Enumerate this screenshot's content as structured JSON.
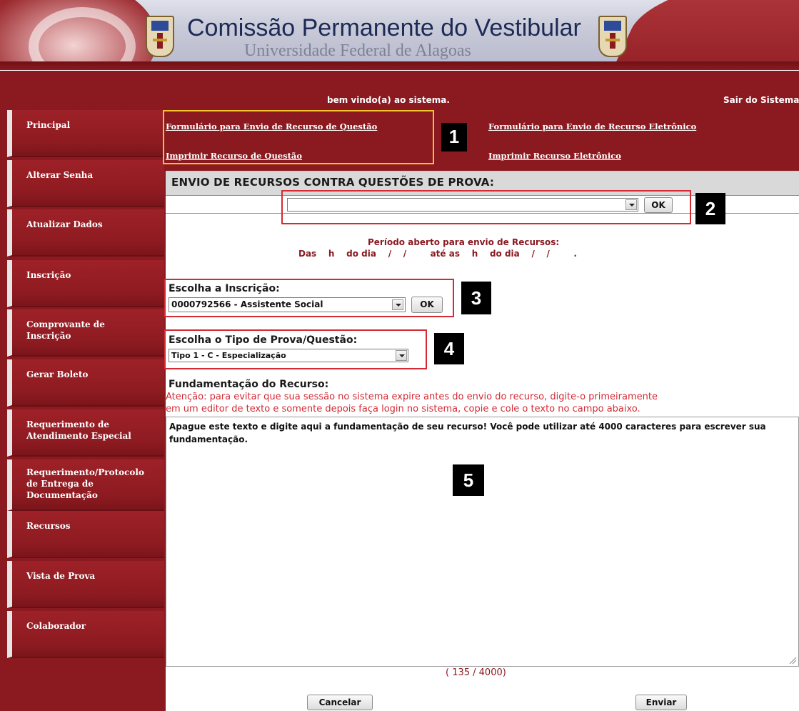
{
  "header": {
    "title": "Comissão Permanente do Vestibular",
    "subtitle": "Universidade Federal de Alagoas"
  },
  "topbar": {
    "welcome": "bem vindo(a) ao sistema.",
    "logout": "Sair do Sistema"
  },
  "sidebar": {
    "items": [
      {
        "label": "Principal"
      },
      {
        "label": "Alterar Senha"
      },
      {
        "label": "Atualizar Dados"
      },
      {
        "label": "Inscrição"
      },
      {
        "label": "Comprovante de\nInscrição"
      },
      {
        "label": "Gerar Boleto"
      },
      {
        "label": "Requerimento de\nAtendimento Especial"
      },
      {
        "label": "Requerimento/Protocolo\nde Entrega de\nDocumentação"
      },
      {
        "label": "Recursos"
      },
      {
        "label": "Vista de Prova"
      },
      {
        "label": "Colaborador"
      }
    ]
  },
  "links": {
    "form_questao": "Formulário para Envio de Recurso de Questão",
    "form_eletronico": "Formulário para Envio de Recurso Eletrônico",
    "print_questao": "Imprimir Recurso de Questão",
    "print_eletronico": "Imprimir Recurso Eletrônico"
  },
  "badges": [
    "1",
    "2",
    "3",
    "4",
    "5"
  ],
  "section": {
    "title": "ENVIO DE RECURSOS CONTRA QUESTÕES DE PROVA:",
    "top_select_value": "",
    "ok_label": "OK"
  },
  "period": {
    "line1": "Período aberto para envio de Recursos:",
    "line2": "Das    h    do dia    /    /        até as    h    do dia    /    /        ."
  },
  "inscricao": {
    "label": "Escolha a Inscrição:",
    "value": "0000792566 - Assistente Social",
    "ok_label": "OK"
  },
  "tipo_prova": {
    "label": "Escolha o Tipo de Prova/Questão:",
    "value": "Tipo 1 - C - Especialização"
  },
  "fundamentacao": {
    "label": "Fundamentação do Recurso:",
    "warning_line1": "Atenção: para evitar que sua sessão no sistema expire antes do envio do recurso, digite-o primeiramente",
    "warning_line2": "em um editor de texto e somente depois faça login no sistema, copie e cole o texto no campo abaixo.",
    "text": "Apague este texto e digite aqui a fundamentação de seu recurso! Você pode utilizar até 4000 caracteres para escrever sua fundamentação.",
    "counter": "( 135 / 4000)"
  },
  "buttons": {
    "cancel": "Cancelar",
    "send": "Enviar"
  },
  "colors": {
    "brand_red": "#8a1a20",
    "highlight_yellow": "#f2c230",
    "highlight_red": "#d22b35"
  }
}
